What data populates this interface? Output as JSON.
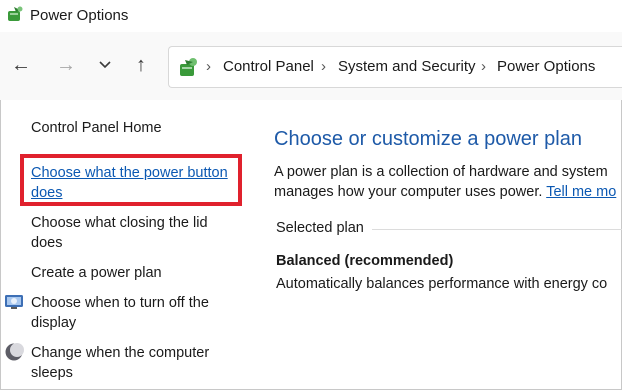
{
  "window": {
    "title": "Power Options"
  },
  "nav": {
    "breadcrumbs": [
      "Control Panel",
      "System and Security",
      "Power Options"
    ]
  },
  "sidebar": {
    "items": [
      {
        "label": "Control Panel Home"
      },
      {
        "label_line1": "Choose what the power button",
        "label_line2": "does"
      },
      {
        "label_line1": "Choose what closing the lid",
        "label_line2": "does"
      },
      {
        "label": "Create a power plan"
      },
      {
        "label_line1": "Choose when to turn off the",
        "label_line2": "display"
      },
      {
        "label_line1": "Change when the computer",
        "label_line2": "sleeps"
      }
    ]
  },
  "main": {
    "title": "Choose or customize a power plan",
    "desc_line1": "A power plan is a collection of hardware and system",
    "desc_line2": "manages how your computer uses power.",
    "tell_me_more": "Tell me mo",
    "selected_plan_label": "Selected plan",
    "plan_name": "Balanced (recommended)",
    "plan_desc": "Automatically balances performance with energy co"
  },
  "colors": {
    "link": "#0b58b2",
    "title": "#1e5aa8",
    "highlight": "#e0212d"
  }
}
